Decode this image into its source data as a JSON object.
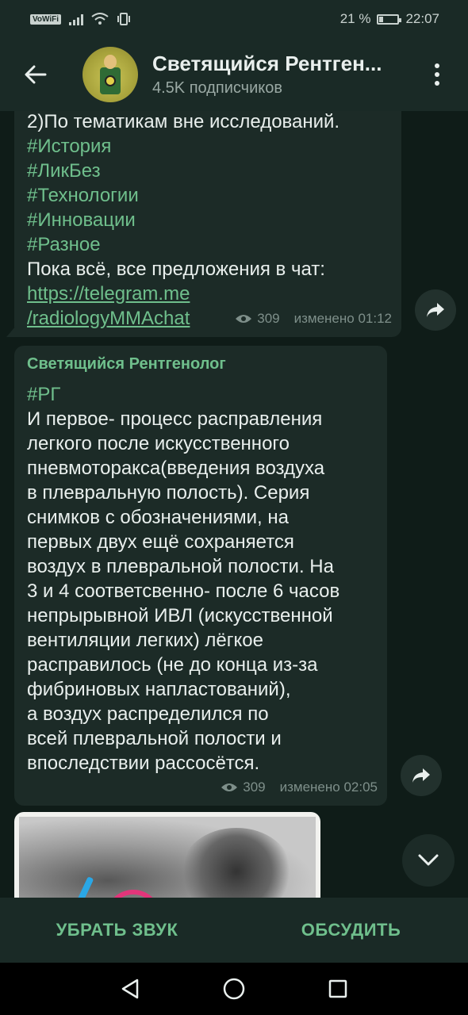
{
  "status_bar": {
    "network_badge": "VoWiFi",
    "battery_percent": "21 %",
    "time": "22:07"
  },
  "header": {
    "title": "Светящийся Рентген...",
    "subtitle": "4.5K подписчиков"
  },
  "messages": [
    {
      "lines": [
        {
          "text": "2)По тематикам вне исследований.",
          "kind": "text"
        },
        {
          "text": "#История",
          "kind": "hashtag"
        },
        {
          "text": "#ЛикБез",
          "kind": "hashtag"
        },
        {
          "text": "#Технологии",
          "kind": "hashtag"
        },
        {
          "text": "#Инновации",
          "kind": "hashtag"
        },
        {
          "text": "#Разное",
          "kind": "hashtag"
        },
        {
          "text": "Пока всё, все предложения в чат:",
          "kind": "text"
        },
        {
          "text": "https://telegram.me",
          "kind": "link"
        },
        {
          "text": "/radiologyMMAchat",
          "kind": "link"
        }
      ],
      "views": "309",
      "edited": "изменено 01:12"
    },
    {
      "sender": "Светящийся Рентгенолог",
      "hashtag": "#РГ",
      "body_lines": [
        "И первое- процесс расправления",
        "легкого после искусственного",
        "пневмоторакса(введения воздуха",
        "в плевральную полость). Серия",
        "снимков с обозначениями, на",
        "первых двух ещё сохраняется",
        "воздух в плевральной полости. На",
        "3 и 4 соответсвенно- после 6 часов",
        "непрырывной ИВЛ (искусственной",
        "вентиляции легких) лёгкое",
        "расправилось (не до конца из-за",
        "фибриновых напластований),",
        "а воздух распределился по",
        "всей плевральной полости и",
        "впоследствии рассосётся."
      ],
      "views": "309",
      "edited": "изменено 02:05"
    }
  ],
  "actions": {
    "mute": "УБРАТЬ ЗВУК",
    "discuss": "ОБСУДИТЬ"
  },
  "colors": {
    "accent": "#6fbf8c",
    "bubble": "#1c2b27",
    "background": "#0f1c18",
    "bar": "#1a2a26"
  },
  "icons": [
    "back-arrow-icon",
    "more-vert-icon",
    "share-icon",
    "eye-icon",
    "chevron-down-icon",
    "nav-back-icon",
    "nav-home-icon",
    "nav-recents-icon"
  ]
}
